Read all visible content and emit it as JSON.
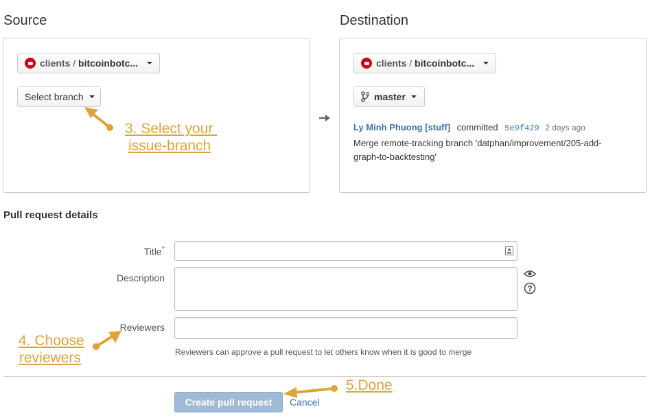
{
  "source": {
    "heading": "Source",
    "repo": {
      "org": "clients",
      "separator": " / ",
      "name": "bitcoinbotc..."
    },
    "branch_button": "Select branch"
  },
  "destination": {
    "heading": "Destination",
    "repo": {
      "org": "clients",
      "separator": " / ",
      "name": "bitcoinbotc..."
    },
    "branch": "master",
    "commit": {
      "author": "Ly Minh Phuong [stuff]",
      "action": "committed",
      "hash": "5e9f429",
      "time": "2 days ago",
      "message_line1": "Merge remote-tracking branch 'datphan/improvement/205-add-",
      "message_line2": "graph-to-backtesting'"
    }
  },
  "details": {
    "heading": "Pull request details",
    "title_label": "Title",
    "required_mark": "*",
    "description_label": "Description",
    "reviewers_label": "Reviewers",
    "reviewers_help": "Reviewers can approve a pull request to let others know when it is good to merge"
  },
  "actions": {
    "create_label": "Create pull request",
    "cancel_label": "Cancel"
  },
  "annotations": {
    "step3_line1": "3. Select your ",
    "step3_line2": "issue-branch",
    "step4_line1": "4. Choose",
    "step4_line2": "reviewers",
    "step5": "5.Done"
  },
  "colors": {
    "accent_link": "#3b73af",
    "annotation": "#e0a33a",
    "repo_icon": "#d0021b",
    "primary_button": "#9fbad6"
  }
}
